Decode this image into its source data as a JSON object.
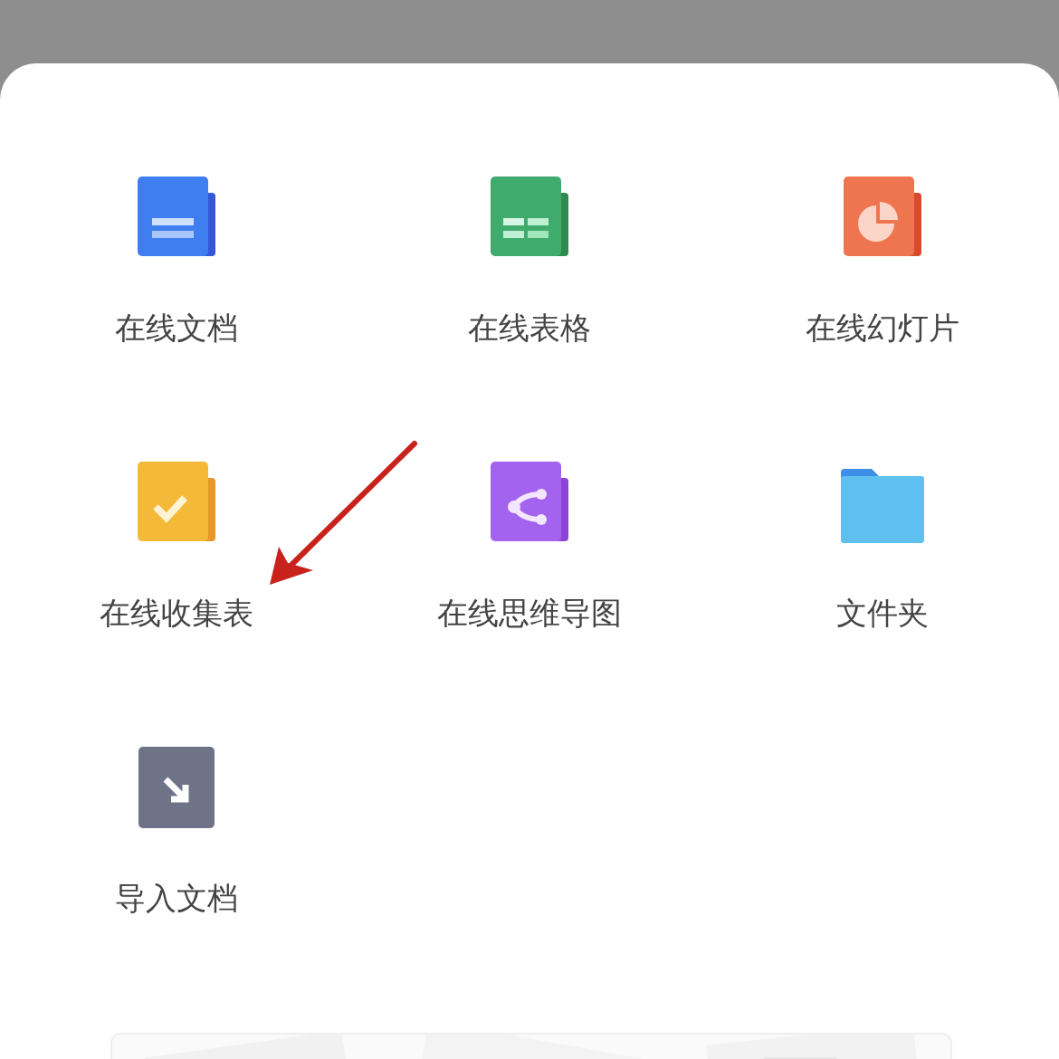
{
  "items": [
    {
      "kind": "doc",
      "label": "在线文档"
    },
    {
      "kind": "sheet",
      "label": "在线表格"
    },
    {
      "kind": "slides",
      "label": "在线幻灯片"
    },
    {
      "kind": "form",
      "label": "在线收集表"
    },
    {
      "kind": "mind",
      "label": "在线思维导图"
    },
    {
      "kind": "folder",
      "label": "文件夹"
    },
    {
      "kind": "import",
      "label": "导入文档"
    }
  ],
  "annotation": {
    "kind": "arrow",
    "color": "#c8221c"
  }
}
